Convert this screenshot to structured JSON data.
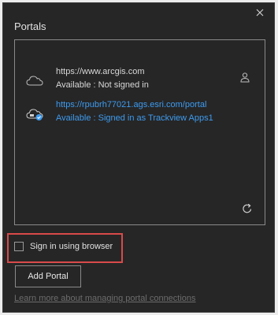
{
  "dialog": {
    "title": "Portals",
    "close_icon": "close-icon"
  },
  "portals": [
    {
      "url": "https://www.arcgis.com",
      "status": "Available : Not signed in",
      "icon": "cloud-icon",
      "action_icon": "user-icon"
    },
    {
      "url": "https://rpubrh77021.ags.esri.com/portal",
      "status": "Available : Signed in as  Trackview Apps1",
      "icon": "cloud-active-icon"
    }
  ],
  "list": {
    "refresh_icon": "refresh-icon"
  },
  "sign_in_browser": {
    "label": "Sign in using browser",
    "checked": false
  },
  "add_portal": {
    "label": "Add Portal"
  },
  "learn_more": {
    "label": "Learn more about managing portal connections"
  },
  "colors": {
    "background": "#262626",
    "active_link": "#3d9bf0",
    "highlight": "#d94a4a"
  }
}
